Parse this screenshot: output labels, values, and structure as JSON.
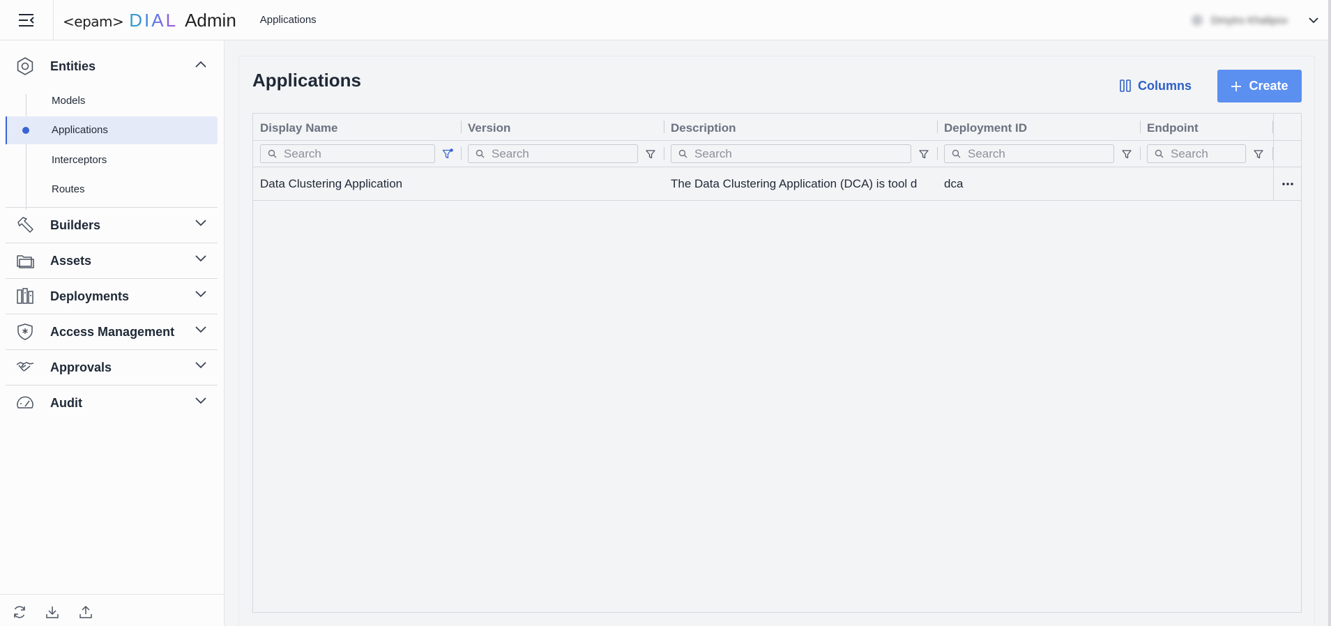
{
  "header": {
    "logo_epam": "<epam>",
    "logo_dial": "DIAL",
    "logo_admin": "Admin",
    "breadcrumb": "Applications",
    "user_name": "Dmytro Khalipov"
  },
  "sidebar": {
    "groups": [
      {
        "label": "Entities",
        "icon": "hexagon-icon",
        "expanded": true
      },
      {
        "label": "Builders",
        "icon": "hammer-icon",
        "expanded": false
      },
      {
        "label": "Assets",
        "icon": "folder-icon",
        "expanded": false
      },
      {
        "label": "Deployments",
        "icon": "deployments-icon",
        "expanded": false
      },
      {
        "label": "Access Management",
        "icon": "shield-icon",
        "expanded": false
      },
      {
        "label": "Approvals",
        "icon": "handshake-icon",
        "expanded": false
      },
      {
        "label": "Audit",
        "icon": "gauge-icon",
        "expanded": false
      }
    ],
    "entities_items": [
      {
        "label": "Models"
      },
      {
        "label": "Applications",
        "active": true
      },
      {
        "label": "Interceptors"
      },
      {
        "label": "Routes"
      }
    ],
    "footer_icons": [
      "refresh-icon",
      "download-icon",
      "upload-icon"
    ]
  },
  "main": {
    "title": "Applications",
    "columns_button": "Columns",
    "create_button": "Create",
    "accent_color": "#5b8ff0",
    "table": {
      "columns": [
        "Display Name",
        "Version",
        "Description",
        "Deployment ID",
        "Endpoint"
      ],
      "search_placeholder": "Search",
      "rows": [
        {
          "display_name": "Data Clustering Application",
          "version": "",
          "description": "The Data Clustering Application (DCA) is tool d",
          "deployment_id": "dca",
          "endpoint": ""
        }
      ]
    }
  }
}
